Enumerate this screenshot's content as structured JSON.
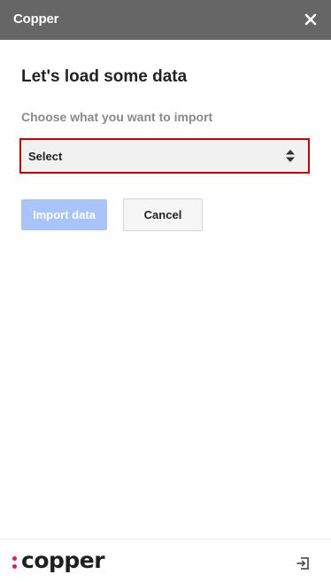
{
  "header": {
    "title": "Copper",
    "close_icon": "close-icon"
  },
  "main": {
    "heading": "Let's load some data",
    "import_label": "Choose what you want to import",
    "select": {
      "value": "Select",
      "arrow_icon": "sort-arrows-icon"
    },
    "buttons": {
      "import_label": "Import data",
      "cancel_label": "Cancel"
    }
  },
  "footer": {
    "logo_text": "copper",
    "logo_icon": "copper-logo-dots",
    "action_icon": "sign-in-icon"
  },
  "colors": {
    "header_bg": "#666666",
    "accent_pink": "#e8175d",
    "primary_disabled": "#a8c4f9",
    "highlight_border": "#d00000"
  }
}
